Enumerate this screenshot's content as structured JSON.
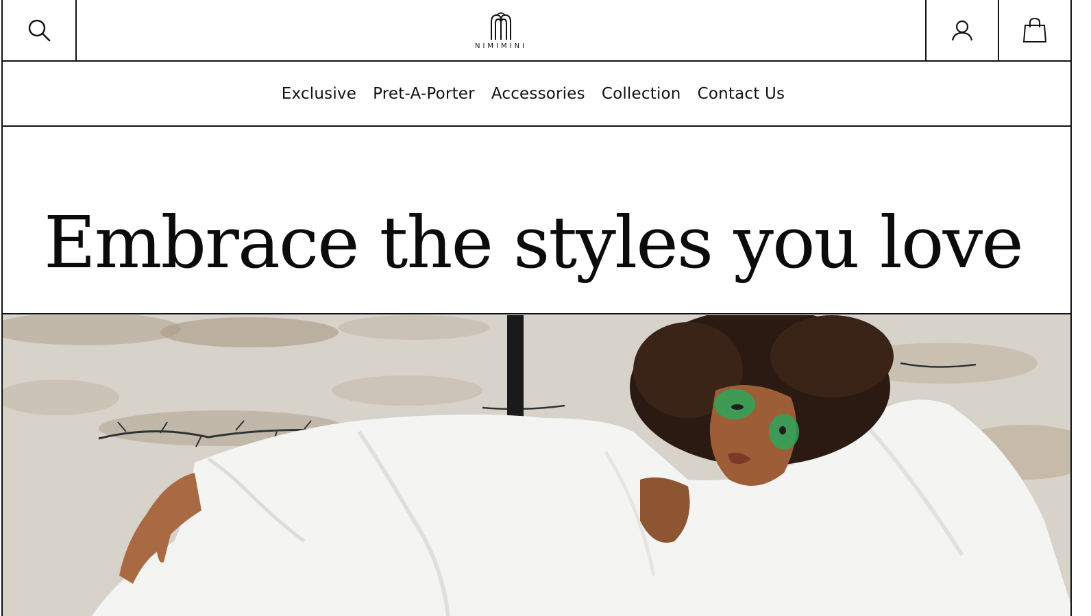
{
  "header": {
    "logo_text": "NIMIMINI",
    "icons": {
      "search": "search-icon",
      "account": "user-icon",
      "cart": "shopping-bag-icon"
    }
  },
  "nav": {
    "items": [
      {
        "label": "Exclusive"
      },
      {
        "label": "Pret-A-Porter"
      },
      {
        "label": "Accessories"
      },
      {
        "label": "Collection"
      },
      {
        "label": "Contact Us"
      }
    ]
  },
  "hero": {
    "title": "Embrace the styles you love"
  },
  "colors": {
    "text": "#111111",
    "border": "#111111",
    "background": "#ffffff"
  }
}
